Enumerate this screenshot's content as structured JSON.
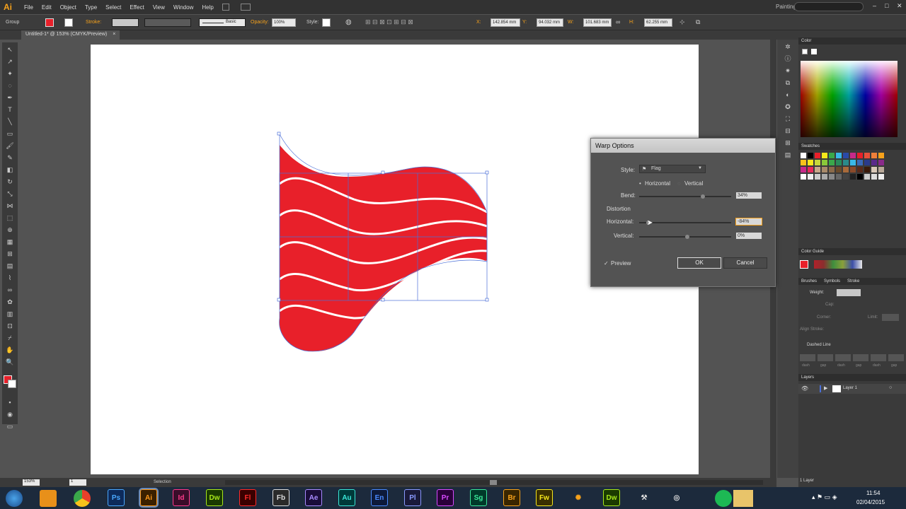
{
  "app": {
    "logo": "Ai",
    "workspace": "Painting"
  },
  "menu": [
    "File",
    "Edit",
    "Object",
    "Type",
    "Select",
    "Effect",
    "View",
    "Window",
    "Help"
  ],
  "control": {
    "selection_label": "Group",
    "stroke_label": "Stroke:",
    "brush_label": "Basic",
    "opacity_label": "Opacity:",
    "opacity_value": "100%",
    "style_label": "Style:",
    "x_label": "X:",
    "x_value": "142.854 mm",
    "y_label": "Y:",
    "y_value": "94.032 mm",
    "w_label": "W:",
    "w_value": "101.683 mm",
    "h_label": "H:",
    "h_value": "62.255 mm"
  },
  "document": {
    "tab_title": "Untitled-1* @ 153% (CMYK/Preview)",
    "close": "×"
  },
  "status": {
    "zoom": "153%",
    "artboard": "1",
    "tool": "Selection"
  },
  "colors": {
    "fill": "#e8202a",
    "accent": "#f7a21b",
    "path": "#4a6fd8"
  },
  "panels": {
    "color": "Color",
    "swatches": "Swatches",
    "color_guide": "Color Guide",
    "tabs": [
      "Brushes",
      "Symbols",
      "Stroke"
    ],
    "stroke": {
      "weight": "Weight:",
      "cap": "Cap:",
      "corner": "Corner:",
      "limit": "Limit:",
      "align": "Align Stroke:",
      "dashed": "Dashed Line",
      "dash_labels": [
        "dash",
        "gap",
        "dash",
        "gap",
        "dash",
        "gap"
      ]
    },
    "layers": {
      "title": "Layers",
      "layer_name": "Layer 1",
      "count": "1 Layer"
    }
  },
  "dialog": {
    "title": "Warp Options",
    "style_label": "Style:",
    "style_value": "Flag",
    "orientation": {
      "horizontal": "Horizontal",
      "vertical": "Vertical",
      "selected": "horizontal"
    },
    "bend_label": "Bend:",
    "bend_value": "34%",
    "bend_level": 0.67,
    "distortion_label": "Distortion",
    "horizontal_label": "Horizontal:",
    "horizontal_value": "-84%",
    "horizontal_level": 0.08,
    "vertical_label": "Vertical:",
    "vertical_value": "0%",
    "vertical_level": 0.5,
    "preview_label": "Preview",
    "preview_checked": true,
    "ok": "OK",
    "cancel": "Cancel"
  },
  "taskbar": {
    "apps": [
      "Ps",
      "Ai",
      "Id",
      "Dw",
      "Fl",
      "Fb",
      "Ae",
      "Au",
      "En",
      "Pl",
      "Pr",
      "Sg",
      "Br",
      "Fw",
      "Dw"
    ],
    "time": "11:54",
    "date": "02/04/2015"
  }
}
